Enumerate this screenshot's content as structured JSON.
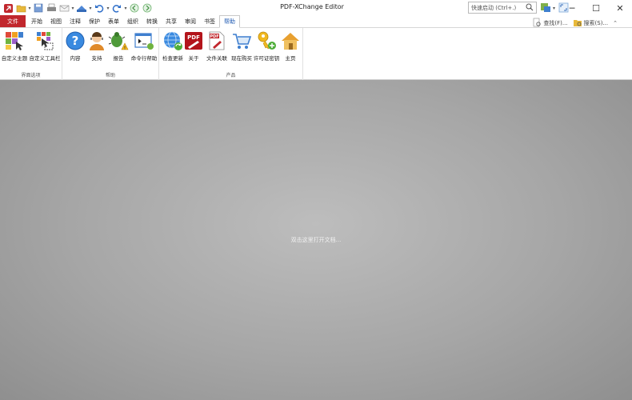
{
  "window": {
    "title": "PDF-XChange Editor",
    "search_placeholder": "快速启动 (Ctrl+.)",
    "minimize": "─",
    "maximize": "☐",
    "close": "✕"
  },
  "tabs": [
    "文件",
    "开始",
    "视图",
    "注释",
    "保护",
    "表单",
    "组织",
    "转换",
    "共享",
    "审阅",
    "书签",
    "帮助"
  ],
  "active_tab": "帮助",
  "tabs_right": {
    "find": "查找(F)...",
    "search": "搜索(S)..."
  },
  "ribbon": {
    "groups": [
      {
        "label": "界面选项",
        "buttons": [
          "自定义主题",
          "自定义工具栏"
        ]
      },
      {
        "label": "帮助",
        "buttons": [
          "内容",
          "支持",
          "报告",
          "命令行帮助"
        ]
      },
      {
        "label": "产品",
        "buttons": [
          "检查更新",
          "关于",
          "文件关联",
          "现在购买",
          "许可证密钥",
          "主页"
        ]
      }
    ]
  },
  "workspace": {
    "hint": "双击这里打开文档..."
  },
  "colors": {
    "file_tab": "#c1272d",
    "active_tab_text": "#1a56b0",
    "workspace": "#a6a6a6"
  }
}
